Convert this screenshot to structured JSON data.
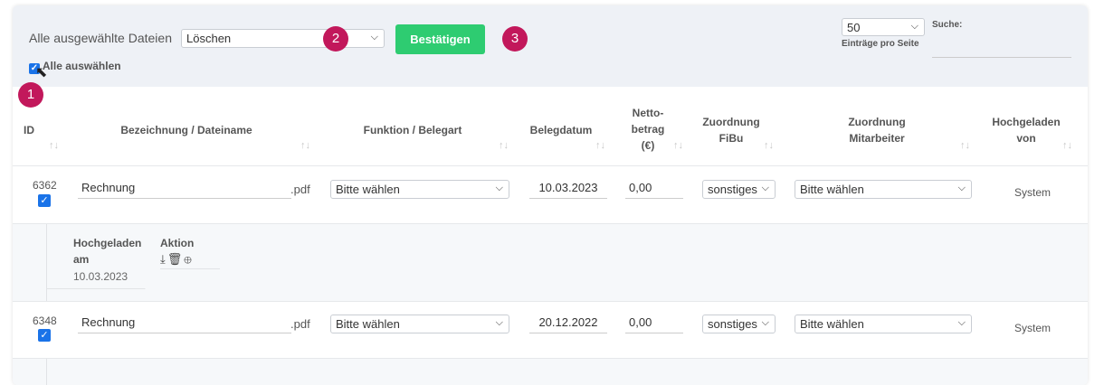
{
  "toolbar": {
    "bulk_label": "Alle ausgewählte Dateien",
    "bulk_action": "Löschen",
    "confirm_label": "Bestätigen",
    "select_all_label": "Alle auswählen",
    "per_page_value": "50",
    "per_page_label": "Einträge pro Seite",
    "search_label": "Suche:"
  },
  "badges": [
    "1",
    "2",
    "3"
  ],
  "columns": [
    "ID",
    "Bezeichnung / Dateiname",
    "Funktion / Belegart",
    "Belegdatum",
    "Netto-\nbetrag\n(€)",
    "Zuordnung\nFiBu",
    "Zuordnung\nMitarbeiter",
    "Hochgeladen\nvon"
  ],
  "rows": [
    {
      "id": "6362",
      "name": "Rechnung",
      "ext": ".pdf",
      "function": "Bitte wählen",
      "date": "10.03.2023",
      "amount": "0,00",
      "fibu": "sonstiges",
      "employee": "Bitte wählen",
      "uploaded_by": "System"
    },
    {
      "id": "6348",
      "name": "Rechnung",
      "ext": ".pdf",
      "function": "Bitte wählen",
      "date": "20.12.2022",
      "amount": "0,00",
      "fibu": "sonstiges",
      "employee": "Bitte wählen",
      "uploaded_by": "System"
    }
  ],
  "detail": {
    "uploaded_at_label": "Hochgeladen\nam",
    "uploaded_at_value": "10.03.2023",
    "action_label": "Aktion",
    "icons": [
      "download-icon",
      "trash-icon",
      "zoom-icon"
    ]
  },
  "colors": {
    "accent": "#2ecc71",
    "badge": "#c2185b",
    "checkbox": "#1a73e8"
  }
}
